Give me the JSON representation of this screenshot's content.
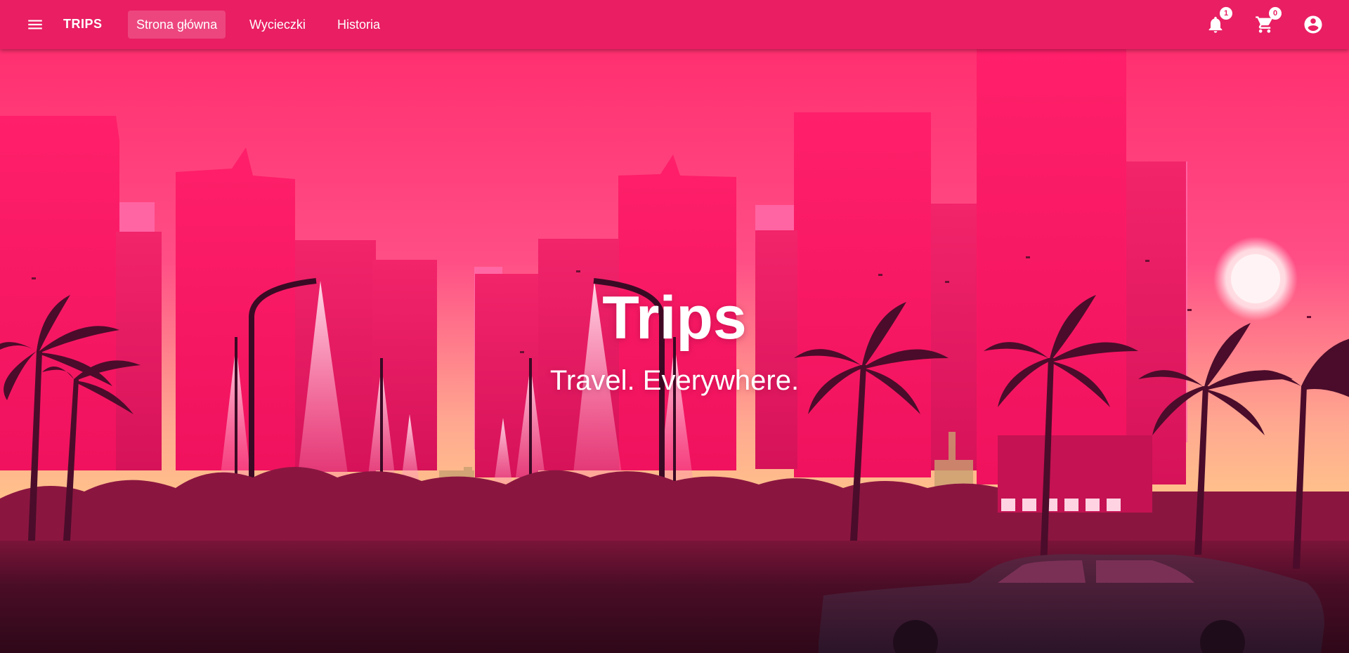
{
  "app": {
    "brand": "TRIPS",
    "primary_color": "#e91e63"
  },
  "nav": {
    "items": [
      {
        "label": "Strona główna",
        "active": true
      },
      {
        "label": "Wycieczki",
        "active": false
      },
      {
        "label": "Historia",
        "active": false
      }
    ]
  },
  "actions": {
    "menu_icon": "menu-icon",
    "notifications": {
      "icon": "bell-icon",
      "count": "1"
    },
    "cart": {
      "icon": "cart-icon",
      "count": "0"
    },
    "account": {
      "icon": "account-circle-icon"
    }
  },
  "hero": {
    "title": "Trips",
    "subtitle": "Travel. Everywhere.",
    "palette": {
      "sky_top": "#ff3b7a",
      "sky_glow": "#ffc07a",
      "ground": "#3a0a22"
    }
  }
}
